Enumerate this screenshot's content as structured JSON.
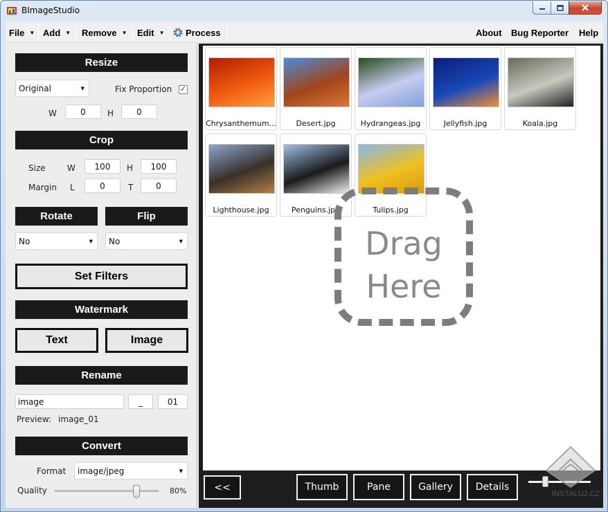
{
  "window": {
    "title": "BImageStudio"
  },
  "menu": {
    "file": "File",
    "add": "Add",
    "remove": "Remove",
    "edit": "Edit",
    "process": "Process",
    "about": "About",
    "bug_reporter": "Bug Reporter",
    "help": "Help"
  },
  "resize": {
    "header": "Resize",
    "mode": "Original",
    "fix_proportion_label": "Fix Proportion",
    "fix_proportion": true,
    "w_label": "W",
    "w": "0",
    "h_label": "H",
    "h": "0"
  },
  "crop": {
    "header": "Crop",
    "size_label": "Size",
    "w_label": "W",
    "w": "100",
    "h_label": "H",
    "h": "100",
    "margin_label": "Margin",
    "l_label": "L",
    "l": "0",
    "t_label": "T",
    "t": "0"
  },
  "rotate": {
    "header": "Rotate",
    "value": "No"
  },
  "flip": {
    "header": "Flip",
    "value": "No"
  },
  "set_filters_label": "Set Filters",
  "watermark": {
    "header": "Watermark",
    "text_label": "Text",
    "image_label": "Image"
  },
  "rename": {
    "header": "Rename",
    "name": "image",
    "separator": "_",
    "number": "01",
    "preview_label": "Preview:",
    "preview": "image_01"
  },
  "convert": {
    "header": "Convert",
    "format_label": "Format",
    "format": "image/jpeg",
    "quality_label": "Quality",
    "quality": "80%",
    "quality_value": 0.8
  },
  "gallery": {
    "items": [
      {
        "name": "Chrysanthemum...",
        "palette": [
          "#b01e04",
          "#f05a10",
          "#ffa040"
        ]
      },
      {
        "name": "Desert.jpg",
        "palette": [
          "#4a8cd6",
          "#a24418",
          "#d8783a"
        ]
      },
      {
        "name": "Hydrangeas.jpg",
        "palette": [
          "#274b1e",
          "#c8ccf0",
          "#7fa1d8"
        ]
      },
      {
        "name": "Jellyfish.jpg",
        "palette": [
          "#0b1e78",
          "#1848b8",
          "#f09030"
        ]
      },
      {
        "name": "Koala.jpg",
        "palette": [
          "#6a6a58",
          "#c8c8c0",
          "#202020"
        ]
      },
      {
        "name": "Lighthouse.jpg",
        "palette": [
          "#8aa6d0",
          "#3a3028",
          "#b08048"
        ]
      },
      {
        "name": "Penguins.jpg",
        "palette": [
          "#9ebfe6",
          "#1a1a1a",
          "#f0f0f0"
        ]
      },
      {
        "name": "Tulips.jpg",
        "palette": [
          "#88b8e8",
          "#f0c020",
          "#d89a10"
        ]
      }
    ],
    "drop_text_1": "Drag",
    "drop_text_2": "Here"
  },
  "bottom": {
    "back": "<<",
    "thumb": "Thumb",
    "pane": "Pane",
    "gallery": "Gallery",
    "details": "Details",
    "zoom": 0.25
  },
  "watermark_text": "INSTALUJ.CZ"
}
